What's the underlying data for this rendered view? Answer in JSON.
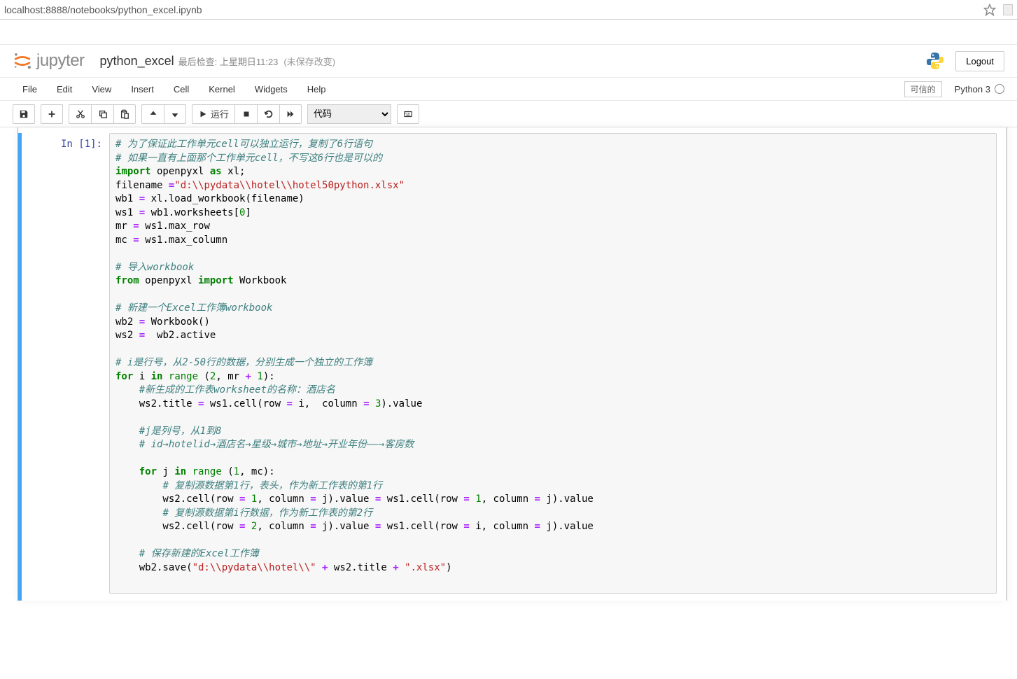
{
  "url": "localhost:8888/notebooks/python_excel.ipynb",
  "logo_text": "jupyter",
  "notebook_title": "python_excel",
  "checkpoint": "最后检查: 上星期日11:23",
  "autosave": "(未保存改变)",
  "logout": "Logout",
  "menu": [
    "File",
    "Edit",
    "View",
    "Insert",
    "Cell",
    "Kernel",
    "Widgets",
    "Help"
  ],
  "trusted": "可信的",
  "kernel": "Python 3",
  "toolbar": {
    "run": "运行",
    "cell_type": "代码"
  },
  "cell": {
    "prompt": "In  [1]:",
    "code_tokens": [
      {
        "t": "# 为了保证此工作单元cell可以独立运行，复制了6行语句",
        "c": "cm-comment"
      },
      {
        "t": "\n"
      },
      {
        "t": "# 如果一直有上面那个工作单元cell，不写这6行也是可以的",
        "c": "cm-comment"
      },
      {
        "t": "\n"
      },
      {
        "t": "import",
        "c": "cm-keyword"
      },
      {
        "t": " openpyxl "
      },
      {
        "t": "as",
        "c": "cm-keyword"
      },
      {
        "t": " xl;\n"
      },
      {
        "t": "filename "
      },
      {
        "t": "=",
        "c": "cm-operator"
      },
      {
        "t": "\"d:\\\\pydata\\\\hotel\\\\hotel50python.xlsx\"",
        "c": "cm-string"
      },
      {
        "t": "\n"
      },
      {
        "t": "wb1 "
      },
      {
        "t": "=",
        "c": "cm-operator"
      },
      {
        "t": " xl.load_workbook(filename)\n"
      },
      {
        "t": "ws1 "
      },
      {
        "t": "=",
        "c": "cm-operator"
      },
      {
        "t": " wb1.worksheets["
      },
      {
        "t": "0",
        "c": "cm-number"
      },
      {
        "t": "]\n"
      },
      {
        "t": "mr "
      },
      {
        "t": "=",
        "c": "cm-operator"
      },
      {
        "t": " ws1.max_row\n"
      },
      {
        "t": "mc "
      },
      {
        "t": "=",
        "c": "cm-operator"
      },
      {
        "t": " ws1.max_column\n"
      },
      {
        "t": "\n"
      },
      {
        "t": "# 导入workbook",
        "c": "cm-comment"
      },
      {
        "t": "\n"
      },
      {
        "t": "from",
        "c": "cm-keyword"
      },
      {
        "t": " openpyxl "
      },
      {
        "t": "import",
        "c": "cm-keyword"
      },
      {
        "t": " Workbook\n"
      },
      {
        "t": "\n"
      },
      {
        "t": "# 新建一个Excel工作簿workbook",
        "c": "cm-comment"
      },
      {
        "t": "\n"
      },
      {
        "t": "wb2 "
      },
      {
        "t": "=",
        "c": "cm-operator"
      },
      {
        "t": " Workbook()\n"
      },
      {
        "t": "ws2 "
      },
      {
        "t": "=",
        "c": "cm-operator"
      },
      {
        "t": "  wb2.active\n"
      },
      {
        "t": "\n"
      },
      {
        "t": "# i是行号，从2-50行的数据，分别生成一个独立的工作簿",
        "c": "cm-comment"
      },
      {
        "t": "\n"
      },
      {
        "t": "for",
        "c": "cm-keyword"
      },
      {
        "t": " i "
      },
      {
        "t": "in",
        "c": "cm-keyword"
      },
      {
        "t": " "
      },
      {
        "t": "range",
        "c": "cm-builtin"
      },
      {
        "t": " ("
      },
      {
        "t": "2",
        "c": "cm-number"
      },
      {
        "t": ", mr "
      },
      {
        "t": "+",
        "c": "cm-operator"
      },
      {
        "t": " "
      },
      {
        "t": "1",
        "c": "cm-number"
      },
      {
        "t": "):\n"
      },
      {
        "t": "    "
      },
      {
        "t": "#新生成的工作表worksheet的名称：酒店名",
        "c": "cm-comment"
      },
      {
        "t": "\n"
      },
      {
        "t": "    ws2.title "
      },
      {
        "t": "=",
        "c": "cm-operator"
      },
      {
        "t": " ws1.cell(row "
      },
      {
        "t": "=",
        "c": "cm-operator"
      },
      {
        "t": " i,  column "
      },
      {
        "t": "=",
        "c": "cm-operator"
      },
      {
        "t": " "
      },
      {
        "t": "3",
        "c": "cm-number"
      },
      {
        "t": ").value\n"
      },
      {
        "t": "    \n"
      },
      {
        "t": "    "
      },
      {
        "t": "#j是列号，从1到8",
        "c": "cm-comment"
      },
      {
        "t": "\n"
      },
      {
        "t": "    "
      },
      {
        "t": "# id→hotelid→酒店名→星级→城市→地址→开业年份——→客房数",
        "c": "cm-comment"
      },
      {
        "t": "\n"
      },
      {
        "t": "    \n"
      },
      {
        "t": "    "
      },
      {
        "t": "for",
        "c": "cm-keyword"
      },
      {
        "t": " j "
      },
      {
        "t": "in",
        "c": "cm-keyword"
      },
      {
        "t": " "
      },
      {
        "t": "range",
        "c": "cm-builtin"
      },
      {
        "t": " ("
      },
      {
        "t": "1",
        "c": "cm-number"
      },
      {
        "t": ", mc):\n"
      },
      {
        "t": "        "
      },
      {
        "t": "# 复制源数据第1行，表头，作为新工作表的第1行",
        "c": "cm-comment"
      },
      {
        "t": "\n"
      },
      {
        "t": "        ws2.cell(row "
      },
      {
        "t": "=",
        "c": "cm-operator"
      },
      {
        "t": " "
      },
      {
        "t": "1",
        "c": "cm-number"
      },
      {
        "t": ", column "
      },
      {
        "t": "=",
        "c": "cm-operator"
      },
      {
        "t": " j).value "
      },
      {
        "t": "=",
        "c": "cm-operator"
      },
      {
        "t": " ws1.cell(row "
      },
      {
        "t": "=",
        "c": "cm-operator"
      },
      {
        "t": " "
      },
      {
        "t": "1",
        "c": "cm-number"
      },
      {
        "t": ", column "
      },
      {
        "t": "=",
        "c": "cm-operator"
      },
      {
        "t": " j).value\n"
      },
      {
        "t": "        "
      },
      {
        "t": "# 复制源数据第i行数据，作为新工作表的第2行",
        "c": "cm-comment"
      },
      {
        "t": "\n"
      },
      {
        "t": "        ws2.cell(row "
      },
      {
        "t": "=",
        "c": "cm-operator"
      },
      {
        "t": " "
      },
      {
        "t": "2",
        "c": "cm-number"
      },
      {
        "t": ", column "
      },
      {
        "t": "=",
        "c": "cm-operator"
      },
      {
        "t": " j).value "
      },
      {
        "t": "=",
        "c": "cm-operator"
      },
      {
        "t": " ws1.cell(row "
      },
      {
        "t": "=",
        "c": "cm-operator"
      },
      {
        "t": " i, column "
      },
      {
        "t": "=",
        "c": "cm-operator"
      },
      {
        "t": " j).value\n"
      },
      {
        "t": "        \n"
      },
      {
        "t": "    "
      },
      {
        "t": "# 保存新建的Excel工作簿",
        "c": "cm-comment"
      },
      {
        "t": "\n"
      },
      {
        "t": "    wb2.save("
      },
      {
        "t": "\"d:\\\\pydata\\\\hotel\\\\\"",
        "c": "cm-string"
      },
      {
        "t": " "
      },
      {
        "t": "+",
        "c": "cm-operator"
      },
      {
        "t": " ws2.title "
      },
      {
        "t": "+",
        "c": "cm-operator"
      },
      {
        "t": " "
      },
      {
        "t": "\".xlsx\"",
        "c": "cm-string"
      },
      {
        "t": ")\n"
      },
      {
        "t": "    "
      }
    ]
  }
}
